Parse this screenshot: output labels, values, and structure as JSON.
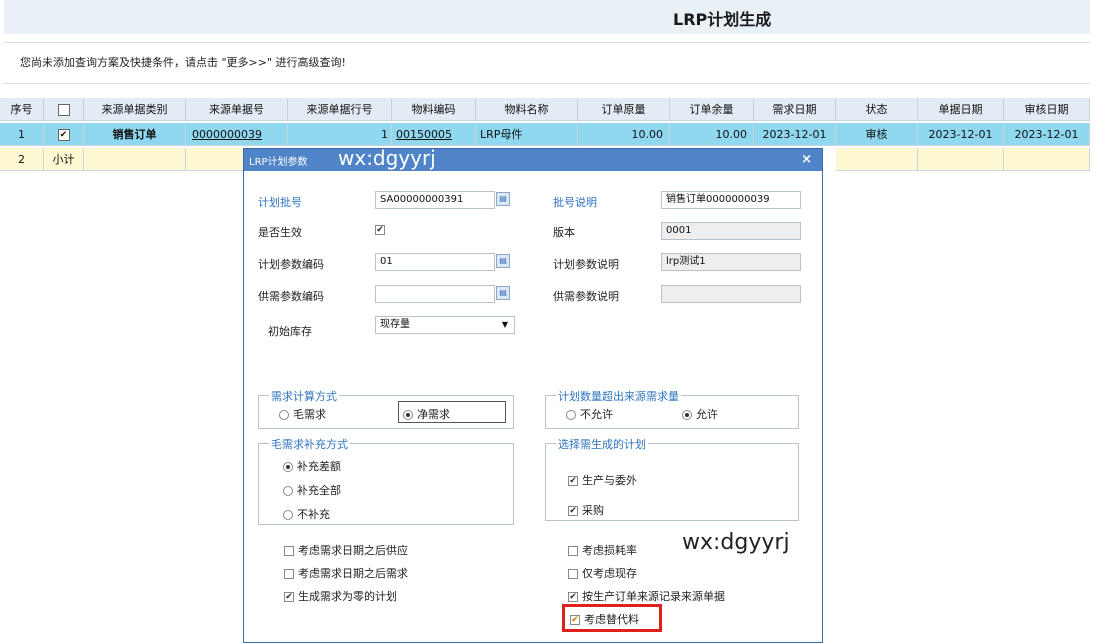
{
  "window": {
    "title": "LRP计划生成"
  },
  "hint": "您尚未添加查询方案及快捷条件，请点击 \"更多>>\" 进行高级查询!",
  "grid": {
    "headers": [
      "序号",
      "",
      "来源单据类别",
      "来源单据号",
      "来源单据行号",
      "物料编码",
      "物料名称",
      "订单原量",
      "订单余量",
      "需求日期",
      "状态",
      "单据日期",
      "审核日期"
    ],
    "rows": [
      {
        "seq": "1",
        "checked": "✔",
        "src_type": "销售订单",
        "src_no": "0000000039",
        "line_no": "1",
        "item_code": "00150005",
        "item_name": "LRP母件",
        "qty": "10.00",
        "remain": "10.00",
        "need_date": "2023-12-01",
        "status": "审核",
        "doc_date": "2023-12-01",
        "audit_date": "2023-12-01"
      },
      {
        "seq": "2",
        "subtotal": "小计"
      }
    ]
  },
  "dialog": {
    "title": "LRP计划参数",
    "watermark": "wx:dgyyrj",
    "close": "×",
    "fields": {
      "plan_batch_label": "计划批号",
      "plan_batch_value": "SA00000000391",
      "batch_desc_label": "批号说明",
      "batch_desc_value": "销售订单0000000039",
      "effective_label": "是否生效",
      "effective_check": "✔",
      "version_label": "版本",
      "version_value": "0001",
      "param_code_label": "计划参数编码",
      "param_code_value": "01",
      "param_desc_label": "计划参数说明",
      "param_desc_value": "lrp测试1",
      "supply_code_label": "供需参数编码",
      "supply_code_value": "",
      "supply_desc_label": "供需参数说明",
      "supply_desc_value": "",
      "init_stock_label": "初始库存",
      "init_stock_value": "现存量"
    },
    "demand_calc": {
      "title": "需求计算方式",
      "options": [
        "毛需求",
        "净需求"
      ],
      "selected": 1
    },
    "over_source": {
      "title": "计划数量超出来源需求量",
      "options": [
        "不允许",
        "允许"
      ],
      "selected": 1
    },
    "gross_supplement": {
      "title": "毛需求补充方式",
      "options": [
        "补充差额",
        "补充全部",
        "不补充"
      ],
      "selected": 0
    },
    "select_plans": {
      "title": "选择需生成的计划",
      "options": [
        "生产与委外",
        "采购"
      ],
      "checked": [
        true,
        true
      ]
    },
    "left_checks": [
      {
        "label": "考虑需求日期之后供应",
        "checked": false
      },
      {
        "label": "考虑需求日期之后需求",
        "checked": false
      },
      {
        "label": "生成需求为零的计划",
        "checked": true
      }
    ],
    "right_checks": [
      {
        "label": "考虑损耗率",
        "checked": false
      },
      {
        "label": "仅考虑现存",
        "checked": false
      },
      {
        "label": "按生产订单来源记录来源单据",
        "checked": true
      },
      {
        "label": "考虑替代料",
        "checked": true
      }
    ],
    "highlight_color": "#e0201a",
    "watermark2": "wx:dgyyrj"
  }
}
